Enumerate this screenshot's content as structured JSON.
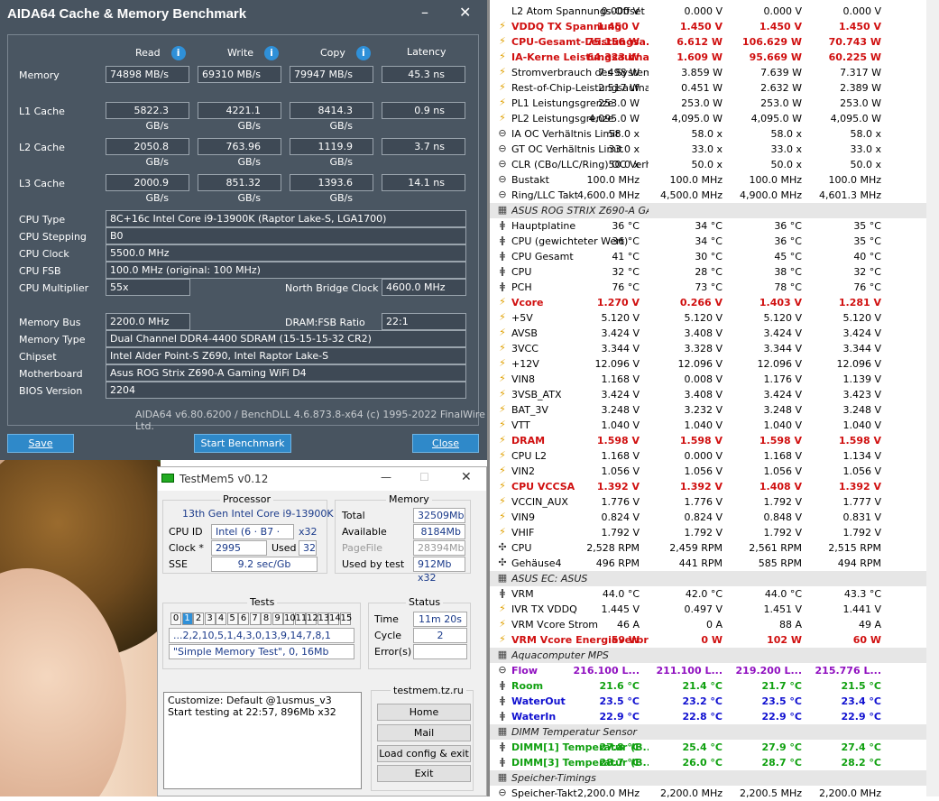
{
  "aida": {
    "title": "AIDA64 Cache & Memory Benchmark",
    "minimize": "–",
    "close": "✕",
    "headers": {
      "read": "Read",
      "write": "Write",
      "copy": "Copy",
      "latency": "Latency"
    },
    "rows": [
      {
        "label": "Memory",
        "read": "74898 MB/s",
        "write": "69310 MB/s",
        "copy": "79947 MB/s",
        "latency": "45.3 ns"
      },
      {
        "label": "L1 Cache",
        "read": "5822.3 GB/s",
        "write": "4221.1 GB/s",
        "copy": "8414.3 GB/s",
        "latency": "0.9 ns"
      },
      {
        "label": "L2 Cache",
        "read": "2050.8 GB/s",
        "write": "763.96 GB/s",
        "copy": "1119.9 GB/s",
        "latency": "3.7 ns"
      },
      {
        "label": "L3 Cache",
        "read": "2000.9 GB/s",
        "write": "851.32 GB/s",
        "copy": "1393.6 GB/s",
        "latency": "14.1 ns"
      }
    ],
    "cpu_type_label": "CPU Type",
    "cpu_type": "8C+16c Intel Core i9-13900K  (Raptor Lake-S, LGA1700)",
    "cpu_stepping_label": "CPU Stepping",
    "cpu_stepping": "B0",
    "cpu_clock_label": "CPU Clock",
    "cpu_clock": "5500.0 MHz",
    "cpu_fsb_label": "CPU FSB",
    "cpu_fsb": "100.0 MHz  (original: 100 MHz)",
    "cpu_mult_label": "CPU Multiplier",
    "cpu_mult": "55x",
    "nb_clock_label": "North Bridge Clock",
    "nb_clock": "4600.0 MHz",
    "mem_bus_label": "Memory Bus",
    "mem_bus": "2200.0 MHz",
    "dram_ratio_label": "DRAM:FSB Ratio",
    "dram_ratio": "22:1",
    "mem_type_label": "Memory Type",
    "mem_type": "Dual Channel DDR4-4400 SDRAM  (15-15-15-32 CR2)",
    "chipset_label": "Chipset",
    "chipset": "Intel Alder Point-S Z690, Intel Raptor Lake-S",
    "mobo_label": "Motherboard",
    "mobo": "Asus ROG Strix Z690-A Gaming WiFi D4",
    "bios_label": "BIOS Version",
    "bios": "2204",
    "footer": "AIDA64 v6.80.6200 / BenchDLL 4.6.873.8-x64  (c) 1995-2022 FinalWire Ltd.",
    "save": "Save",
    "start": "Start Benchmark",
    "close_btn": "Close"
  },
  "tm": {
    "title": "TestMem5 v0.12",
    "processor_label": "Processor",
    "processor": "13th Gen Intel Core i9-13900K",
    "cpuid_label": "CPU ID",
    "cpuid": "Intel  (6 · B7 · 1)",
    "cpuid_x": "x32",
    "clock_label": "Clock *",
    "clock": "2995 MHz",
    "used_label": "Used",
    "used": "32",
    "sse_label": "SSE",
    "sse": "9.2 sec/Gb",
    "memory_label": "Memory",
    "total_label": "Total",
    "total": "32509Mb",
    "avail_label": "Available",
    "avail": "8184Mb",
    "pagefile_label": "PageFile",
    "pagefile": "28394Mb",
    "usedby_label": "Used by test",
    "usedby": "912Mb x32",
    "tests_label": "Tests",
    "test_nums": [
      "0",
      "1",
      "2",
      "3",
      "4",
      "5",
      "6",
      "7",
      "8",
      "9",
      "10",
      "11",
      "12",
      "13",
      "14",
      "15"
    ],
    "sequence": "...2,2,10,5,1,4,3,0,13,9,14,7,8,1",
    "current_test": "\"Simple Memory Test\", 0,  16Mb",
    "status_label": "Status",
    "time_label": "Time",
    "time": "11m 20s",
    "cycle_label": "Cycle",
    "cycle": "2",
    "errors_label": "Error(s)",
    "errors": "",
    "log_line1": "Customize: Default @1usmus_v3",
    "log_line2": "Start testing at 22:57, 896Mb x32",
    "site": "testmem.tz.ru",
    "btn_home": "Home",
    "btn_mail": "Mail",
    "btn_load": "Load config & exit",
    "btn_exit": "Exit"
  },
  "hw": [
    {
      "n": "L2 Atom Spannungs-Offset",
      "v": [
        "0.000 V",
        "0.000 V",
        "0.000 V",
        "0.000 V"
      ],
      "icon": "",
      "style": ""
    },
    {
      "n": "VDDQ TX Spannung",
      "v": [
        "1.450 V",
        "1.450 V",
        "1.450 V",
        "1.450 V"
      ],
      "icon": "bolt",
      "style": "red"
    },
    {
      "n": "CPU-Gesamt-Leistungsa...",
      "v": [
        "75.156 W",
        "6.612 W",
        "106.629 W",
        "70.743 W"
      ],
      "icon": "bolt",
      "style": "red"
    },
    {
      "n": "IA-Kerne Leistungsaufna...",
      "v": [
        "64.323 W",
        "1.609 W",
        "95.669 W",
        "60.225 W"
      ],
      "icon": "bolt",
      "style": "red"
    },
    {
      "n": "Stromverbrauch des System ...",
      "v": [
        "7.498 W",
        "3.859 W",
        "7.639 W",
        "7.317 W"
      ],
      "icon": "bolt",
      "style": ""
    },
    {
      "n": "Rest-of-Chip-Leistungsaufna...",
      "v": [
        "2.517 W",
        "0.451 W",
        "2.632 W",
        "2.389 W"
      ],
      "icon": "bolt",
      "style": ""
    },
    {
      "n": "PL1 Leistungsgrenze",
      "v": [
        "253.0 W",
        "253.0 W",
        "253.0 W",
        "253.0 W"
      ],
      "icon": "bolt",
      "style": ""
    },
    {
      "n": "PL2 Leistungsgrenze",
      "v": [
        "4,095.0 W",
        "4,095.0 W",
        "4,095.0 W",
        "4,095.0 W"
      ],
      "icon": "bolt",
      "style": ""
    },
    {
      "n": "IA OC Verhältnis Limit",
      "v": [
        "58.0 x",
        "58.0 x",
        "58.0 x",
        "58.0 x"
      ],
      "icon": "clock",
      "style": ""
    },
    {
      "n": "GT OC Verhältnis Limit",
      "v": [
        "33.0 x",
        "33.0 x",
        "33.0 x",
        "33.0 x"
      ],
      "icon": "clock",
      "style": ""
    },
    {
      "n": "CLR (CBo/LLC/Ring) OC Verh...",
      "v": [
        "50.0 x",
        "50.0 x",
        "50.0 x",
        "50.0 x"
      ],
      "icon": "clock",
      "style": ""
    },
    {
      "n": "Bustakt",
      "v": [
        "100.0 MHz",
        "100.0 MHz",
        "100.0 MHz",
        "100.0 MHz"
      ],
      "icon": "clock",
      "style": ""
    },
    {
      "n": "Ring/LLC Takt",
      "v": [
        "4,600.0 MHz",
        "4,500.0 MHz",
        "4,900.0 MHz",
        "4,601.3 MHz"
      ],
      "icon": "clock",
      "style": ""
    },
    {
      "n": "ASUS ROG STRIX Z690-A GA...",
      "v": [
        "",
        "",
        "",
        ""
      ],
      "icon": "chip",
      "style": "sec"
    },
    {
      "n": "Hauptplatine",
      "v": [
        "36 °C",
        "34 °C",
        "36 °C",
        "35 °C"
      ],
      "icon": "therm",
      "style": ""
    },
    {
      "n": "CPU (gewichteter Wert)",
      "v": [
        "36 °C",
        "34 °C",
        "36 °C",
        "35 °C"
      ],
      "icon": "therm",
      "style": ""
    },
    {
      "n": "CPU Gesamt",
      "v": [
        "41 °C",
        "30 °C",
        "45 °C",
        "40 °C"
      ],
      "icon": "therm",
      "style": ""
    },
    {
      "n": "CPU",
      "v": [
        "32 °C",
        "28 °C",
        "38 °C",
        "32 °C"
      ],
      "icon": "therm",
      "style": ""
    },
    {
      "n": "PCH",
      "v": [
        "76 °C",
        "73 °C",
        "78 °C",
        "76 °C"
      ],
      "icon": "therm",
      "style": ""
    },
    {
      "n": "Vcore",
      "v": [
        "1.270 V",
        "0.266 V",
        "1.403 V",
        "1.281 V"
      ],
      "icon": "bolt",
      "style": "red"
    },
    {
      "n": "+5V",
      "v": [
        "5.120 V",
        "5.120 V",
        "5.120 V",
        "5.120 V"
      ],
      "icon": "bolt",
      "style": ""
    },
    {
      "n": "AVSB",
      "v": [
        "3.424 V",
        "3.408 V",
        "3.424 V",
        "3.424 V"
      ],
      "icon": "bolt",
      "style": ""
    },
    {
      "n": "3VCC",
      "v": [
        "3.344 V",
        "3.328 V",
        "3.344 V",
        "3.344 V"
      ],
      "icon": "bolt",
      "style": ""
    },
    {
      "n": "+12V",
      "v": [
        "12.096 V",
        "12.096 V",
        "12.096 V",
        "12.096 V"
      ],
      "icon": "bolt",
      "style": ""
    },
    {
      "n": "VIN8",
      "v": [
        "1.168 V",
        "0.008 V",
        "1.176 V",
        "1.139 V"
      ],
      "icon": "bolt",
      "style": ""
    },
    {
      "n": "3VSB_ATX",
      "v": [
        "3.424 V",
        "3.408 V",
        "3.424 V",
        "3.423 V"
      ],
      "icon": "bolt",
      "style": ""
    },
    {
      "n": "BAT_3V",
      "v": [
        "3.248 V",
        "3.232 V",
        "3.248 V",
        "3.248 V"
      ],
      "icon": "bolt",
      "style": ""
    },
    {
      "n": "VTT",
      "v": [
        "1.040 V",
        "1.040 V",
        "1.040 V",
        "1.040 V"
      ],
      "icon": "bolt",
      "style": ""
    },
    {
      "n": "DRAM",
      "v": [
        "1.598 V",
        "1.598 V",
        "1.598 V",
        "1.598 V"
      ],
      "icon": "bolt",
      "style": "red"
    },
    {
      "n": "CPU L2",
      "v": [
        "1.168 V",
        "0.000 V",
        "1.168 V",
        "1.134 V"
      ],
      "icon": "bolt",
      "style": ""
    },
    {
      "n": "VIN2",
      "v": [
        "1.056 V",
        "1.056 V",
        "1.056 V",
        "1.056 V"
      ],
      "icon": "bolt",
      "style": ""
    },
    {
      "n": "CPU VCCSA",
      "v": [
        "1.392 V",
        "1.392 V",
        "1.408 V",
        "1.392 V"
      ],
      "icon": "bolt",
      "style": "red"
    },
    {
      "n": "VCCIN_AUX",
      "v": [
        "1.776 V",
        "1.776 V",
        "1.792 V",
        "1.777 V"
      ],
      "icon": "bolt",
      "style": ""
    },
    {
      "n": "VIN9",
      "v": [
        "0.824 V",
        "0.824 V",
        "0.848 V",
        "0.831 V"
      ],
      "icon": "bolt",
      "style": ""
    },
    {
      "n": "VHIF",
      "v": [
        "1.792 V",
        "1.792 V",
        "1.792 V",
        "1.792 V"
      ],
      "icon": "bolt",
      "style": ""
    },
    {
      "n": "CPU",
      "v": [
        "2,528 RPM",
        "2,459 RPM",
        "2,561 RPM",
        "2,515 RPM"
      ],
      "icon": "fan",
      "style": ""
    },
    {
      "n": "Gehäuse4",
      "v": [
        "496 RPM",
        "441 RPM",
        "585 RPM",
        "494 RPM"
      ],
      "icon": "fan",
      "style": ""
    },
    {
      "n": "ASUS EC: ASUS",
      "v": [
        "",
        "",
        "",
        ""
      ],
      "icon": "chip",
      "style": "sec"
    },
    {
      "n": "VRM",
      "v": [
        "44.0 °C",
        "42.0 °C",
        "44.0 °C",
        "43.3 °C"
      ],
      "icon": "therm",
      "style": ""
    },
    {
      "n": "IVR TX VDDQ",
      "v": [
        "1.445 V",
        "0.497 V",
        "1.451 V",
        "1.441 V"
      ],
      "icon": "bolt",
      "style": ""
    },
    {
      "n": "VRM Vcore Strom",
      "v": [
        "46 A",
        "0 A",
        "88 A",
        "49 A"
      ],
      "icon": "bolt",
      "style": ""
    },
    {
      "n": "VRM Vcore Energieverbra...",
      "v": [
        "59 W",
        "0 W",
        "102 W",
        "60 W"
      ],
      "icon": "bolt",
      "style": "red"
    },
    {
      "n": "Aquacomputer MPS",
      "v": [
        "",
        "",
        "",
        ""
      ],
      "icon": "chip",
      "style": "sec"
    },
    {
      "n": "Flow",
      "v": [
        "216.100 L...",
        "211.100 L...",
        "219.200 L...",
        "215.776 L..."
      ],
      "icon": "clock",
      "style": "pur"
    },
    {
      "n": "Room",
      "v": [
        "21.6 °C",
        "21.4 °C",
        "21.7 °C",
        "21.5 °C"
      ],
      "icon": "therm",
      "style": "grn"
    },
    {
      "n": "WaterOut",
      "v": [
        "23.5 °C",
        "23.2 °C",
        "23.5 °C",
        "23.4 °C"
      ],
      "icon": "therm",
      "style": "blu"
    },
    {
      "n": "WaterIn",
      "v": [
        "22.9 °C",
        "22.8 °C",
        "22.9 °C",
        "22.9 °C"
      ],
      "icon": "therm",
      "style": "blu"
    },
    {
      "n": "DIMM Temperatur Sensor",
      "v": [
        "",
        "",
        "",
        ""
      ],
      "icon": "chip",
      "style": "sec"
    },
    {
      "n": "DIMM[1] Temperatur (B...",
      "v": [
        "27.8 °C",
        "25.4 °C",
        "27.9 °C",
        "27.4 °C"
      ],
      "icon": "therm",
      "style": "grn"
    },
    {
      "n": "DIMM[3] Temperatur (B...",
      "v": [
        "28.7 °C",
        "26.0 °C",
        "28.7 °C",
        "28.2 °C"
      ],
      "icon": "therm",
      "style": "grn"
    },
    {
      "n": "Speicher-Timings",
      "v": [
        "",
        "",
        "",
        ""
      ],
      "icon": "chip",
      "style": "sec"
    },
    {
      "n": "Speicher-Takt",
      "v": [
        "2,200.0 MHz",
        "2,200.0 MHz",
        "2,200.5 MHz",
        "2,200.0 MHz"
      ],
      "icon": "clock",
      "style": ""
    }
  ]
}
